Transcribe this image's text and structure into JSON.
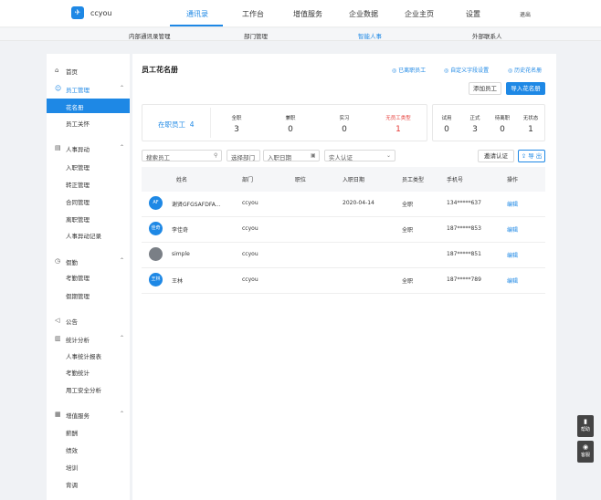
{
  "brand": {
    "name": "ccyou",
    "logo_icon": "bird-logo"
  },
  "topnav": {
    "items": [
      "通讯录",
      "工作台",
      "增值服务",
      "企业数据",
      "企业主页",
      "设置"
    ],
    "active_index": 0,
    "logout": "退出"
  },
  "subnav": {
    "items": [
      "内部通讯录管理",
      "部门管理",
      "智能人事",
      "外部联系人"
    ],
    "active_index": 2
  },
  "sidebar": {
    "home": "首页",
    "groups": [
      {
        "label": "员工管理",
        "items": [
          "花名册",
          "员工关怀"
        ]
      },
      {
        "label": "人事异动",
        "items": [
          "入职管理",
          "转正管理",
          "合同管理",
          "离职管理",
          "人事异动记录"
        ]
      },
      {
        "label": "假勤",
        "items": [
          "考勤管理",
          "假期管理"
        ]
      },
      {
        "label": "公告",
        "items": []
      },
      {
        "label": "统计分析",
        "items": [
          "人事统计报表",
          "考勤统计",
          "用工安全分析"
        ]
      },
      {
        "label": "增值服务",
        "items": [
          "薪酬",
          "绩效",
          "培训",
          "背调"
        ]
      }
    ]
  },
  "page": {
    "title": "员工花名册",
    "links": [
      "已离职员工",
      "自定义字段设置",
      "历史花名册"
    ],
    "add_employee": "添加员工",
    "import_roster": "导入花名册"
  },
  "stats": {
    "onjob_label": "在职员工",
    "onjob_count": "4",
    "group1": [
      {
        "label": "全职",
        "value": "3"
      },
      {
        "label": "兼职",
        "value": "0"
      },
      {
        "label": "实习",
        "value": "0"
      },
      {
        "label": "无员工类型",
        "value": "1"
      }
    ],
    "group2": [
      {
        "label": "试用",
        "value": "0"
      },
      {
        "label": "正式",
        "value": "3"
      },
      {
        "label": "待离职",
        "value": "0"
      },
      {
        "label": "无状态",
        "value": "1"
      }
    ]
  },
  "filters": {
    "search_placeholder": "搜索员工",
    "dept": "选择部门",
    "date": "入职日期",
    "auth": "实人认证",
    "invite": "邀请认证",
    "export": "导 出"
  },
  "table": {
    "columns": [
      "姓名",
      "部门",
      "职位",
      "入职日期",
      "员工类型",
      "手机号",
      "操作"
    ],
    "rows": [
      {
        "avatar": "AF",
        "name": "谢贤GFGSAFDFA...",
        "dept": "ccyou",
        "position": "",
        "date": "2020-04-14",
        "type": "全职",
        "phone": "134*****637",
        "action": "编辑"
      },
      {
        "avatar": "佳奇",
        "name": "李佳奇",
        "dept": "ccyou",
        "position": "",
        "date": "",
        "type": "全职",
        "phone": "187*****853",
        "action": "编辑"
      },
      {
        "avatar": "",
        "name": "simple",
        "dept": "ccyou",
        "position": "",
        "date": "",
        "type": "",
        "phone": "187*****851",
        "action": "编辑"
      },
      {
        "avatar": "王林",
        "name": "王林",
        "dept": "ccyou",
        "position": "",
        "date": "",
        "type": "全职",
        "phone": "187*****789",
        "action": "编辑"
      }
    ]
  },
  "float": {
    "help": "帮助",
    "service": "客服"
  },
  "colors": {
    "accent": "#1e88e5",
    "danger": "#e53935"
  }
}
